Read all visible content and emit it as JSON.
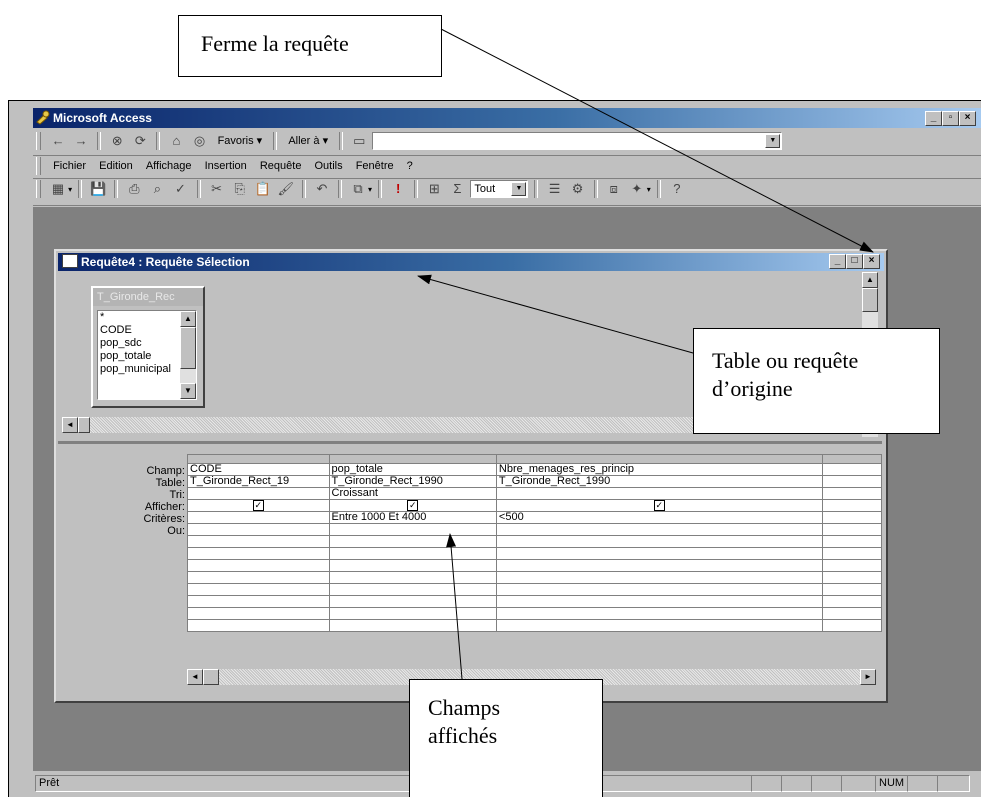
{
  "callouts": {
    "close_query": "Ferme la requête",
    "source_table_line1": "Table ou requête",
    "source_table_line2": "d’origine",
    "fields_shown_line1": "Champs",
    "fields_shown_line2": "affichés"
  },
  "app": {
    "title": "Microsoft Access",
    "web_toolbar": {
      "favorites": "Favoris",
      "goto": "Aller à"
    },
    "menu": [
      "Fichier",
      "Edition",
      "Affichage",
      "Insertion",
      "Requête",
      "Outils",
      "Fenêtre",
      "?"
    ],
    "toolbar": {
      "top_values": "Tout"
    }
  },
  "query_window": {
    "title": "Requête4 : Requête Sélection",
    "field_list": {
      "title": "T_Gironde_Rec",
      "items": [
        "*",
        "CODE",
        "pop_sdc",
        "pop_totale",
        "pop_municipal"
      ]
    },
    "grid": {
      "row_labels": [
        "Champ:",
        "Table:",
        "Tri:",
        "Afficher:",
        "Critères:",
        "Ou:"
      ],
      "columns": [
        {
          "field": "CODE",
          "table": "T_Gironde_Rect_19",
          "sort": "",
          "show": true,
          "criteria": ""
        },
        {
          "field": "pop_totale",
          "table": "T_Gironde_Rect_1990",
          "sort": "Croissant",
          "show": true,
          "criteria": "Entre 1000 Et 4000"
        },
        {
          "field": "Nbre_menages_res_princip",
          "table": "T_Gironde_Rect_1990",
          "sort": "",
          "show": true,
          "criteria": "<500"
        }
      ]
    }
  },
  "status": {
    "text": "Prêt",
    "num": "NUM"
  },
  "colors": {
    "title_start": "#0a246a",
    "title_end": "#a6caf0",
    "face": "#c0c0c0"
  }
}
